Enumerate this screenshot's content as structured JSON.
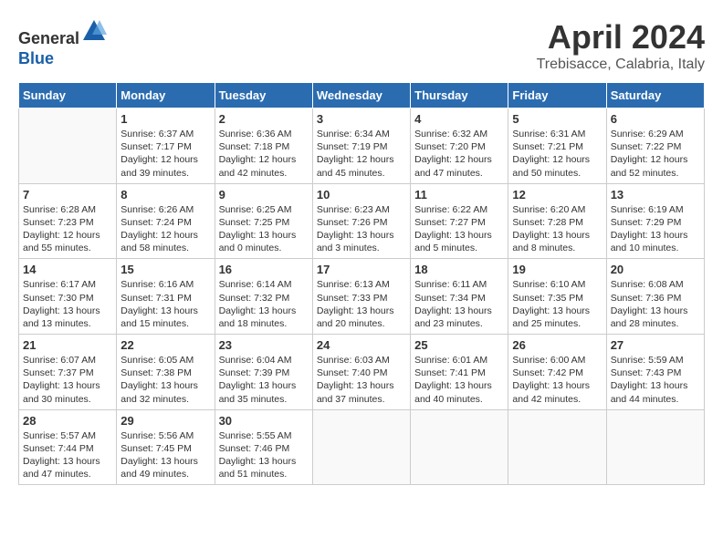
{
  "header": {
    "logo_line1": "General",
    "logo_line2": "Blue",
    "month_title": "April 2024",
    "location": "Trebisacce, Calabria, Italy"
  },
  "weekdays": [
    "Sunday",
    "Monday",
    "Tuesday",
    "Wednesday",
    "Thursday",
    "Friday",
    "Saturday"
  ],
  "weeks": [
    [
      {
        "day": "",
        "info": ""
      },
      {
        "day": "1",
        "info": "Sunrise: 6:37 AM\nSunset: 7:17 PM\nDaylight: 12 hours\nand 39 minutes."
      },
      {
        "day": "2",
        "info": "Sunrise: 6:36 AM\nSunset: 7:18 PM\nDaylight: 12 hours\nand 42 minutes."
      },
      {
        "day": "3",
        "info": "Sunrise: 6:34 AM\nSunset: 7:19 PM\nDaylight: 12 hours\nand 45 minutes."
      },
      {
        "day": "4",
        "info": "Sunrise: 6:32 AM\nSunset: 7:20 PM\nDaylight: 12 hours\nand 47 minutes."
      },
      {
        "day": "5",
        "info": "Sunrise: 6:31 AM\nSunset: 7:21 PM\nDaylight: 12 hours\nand 50 minutes."
      },
      {
        "day": "6",
        "info": "Sunrise: 6:29 AM\nSunset: 7:22 PM\nDaylight: 12 hours\nand 52 minutes."
      }
    ],
    [
      {
        "day": "7",
        "info": "Sunrise: 6:28 AM\nSunset: 7:23 PM\nDaylight: 12 hours\nand 55 minutes."
      },
      {
        "day": "8",
        "info": "Sunrise: 6:26 AM\nSunset: 7:24 PM\nDaylight: 12 hours\nand 58 minutes."
      },
      {
        "day": "9",
        "info": "Sunrise: 6:25 AM\nSunset: 7:25 PM\nDaylight: 13 hours\nand 0 minutes."
      },
      {
        "day": "10",
        "info": "Sunrise: 6:23 AM\nSunset: 7:26 PM\nDaylight: 13 hours\nand 3 minutes."
      },
      {
        "day": "11",
        "info": "Sunrise: 6:22 AM\nSunset: 7:27 PM\nDaylight: 13 hours\nand 5 minutes."
      },
      {
        "day": "12",
        "info": "Sunrise: 6:20 AM\nSunset: 7:28 PM\nDaylight: 13 hours\nand 8 minutes."
      },
      {
        "day": "13",
        "info": "Sunrise: 6:19 AM\nSunset: 7:29 PM\nDaylight: 13 hours\nand 10 minutes."
      }
    ],
    [
      {
        "day": "14",
        "info": "Sunrise: 6:17 AM\nSunset: 7:30 PM\nDaylight: 13 hours\nand 13 minutes."
      },
      {
        "day": "15",
        "info": "Sunrise: 6:16 AM\nSunset: 7:31 PM\nDaylight: 13 hours\nand 15 minutes."
      },
      {
        "day": "16",
        "info": "Sunrise: 6:14 AM\nSunset: 7:32 PM\nDaylight: 13 hours\nand 18 minutes."
      },
      {
        "day": "17",
        "info": "Sunrise: 6:13 AM\nSunset: 7:33 PM\nDaylight: 13 hours\nand 20 minutes."
      },
      {
        "day": "18",
        "info": "Sunrise: 6:11 AM\nSunset: 7:34 PM\nDaylight: 13 hours\nand 23 minutes."
      },
      {
        "day": "19",
        "info": "Sunrise: 6:10 AM\nSunset: 7:35 PM\nDaylight: 13 hours\nand 25 minutes."
      },
      {
        "day": "20",
        "info": "Sunrise: 6:08 AM\nSunset: 7:36 PM\nDaylight: 13 hours\nand 28 minutes."
      }
    ],
    [
      {
        "day": "21",
        "info": "Sunrise: 6:07 AM\nSunset: 7:37 PM\nDaylight: 13 hours\nand 30 minutes."
      },
      {
        "day": "22",
        "info": "Sunrise: 6:05 AM\nSunset: 7:38 PM\nDaylight: 13 hours\nand 32 minutes."
      },
      {
        "day": "23",
        "info": "Sunrise: 6:04 AM\nSunset: 7:39 PM\nDaylight: 13 hours\nand 35 minutes."
      },
      {
        "day": "24",
        "info": "Sunrise: 6:03 AM\nSunset: 7:40 PM\nDaylight: 13 hours\nand 37 minutes."
      },
      {
        "day": "25",
        "info": "Sunrise: 6:01 AM\nSunset: 7:41 PM\nDaylight: 13 hours\nand 40 minutes."
      },
      {
        "day": "26",
        "info": "Sunrise: 6:00 AM\nSunset: 7:42 PM\nDaylight: 13 hours\nand 42 minutes."
      },
      {
        "day": "27",
        "info": "Sunrise: 5:59 AM\nSunset: 7:43 PM\nDaylight: 13 hours\nand 44 minutes."
      }
    ],
    [
      {
        "day": "28",
        "info": "Sunrise: 5:57 AM\nSunset: 7:44 PM\nDaylight: 13 hours\nand 47 minutes."
      },
      {
        "day": "29",
        "info": "Sunrise: 5:56 AM\nSunset: 7:45 PM\nDaylight: 13 hours\nand 49 minutes."
      },
      {
        "day": "30",
        "info": "Sunrise: 5:55 AM\nSunset: 7:46 PM\nDaylight: 13 hours\nand 51 minutes."
      },
      {
        "day": "",
        "info": ""
      },
      {
        "day": "",
        "info": ""
      },
      {
        "day": "",
        "info": ""
      },
      {
        "day": "",
        "info": ""
      }
    ]
  ]
}
